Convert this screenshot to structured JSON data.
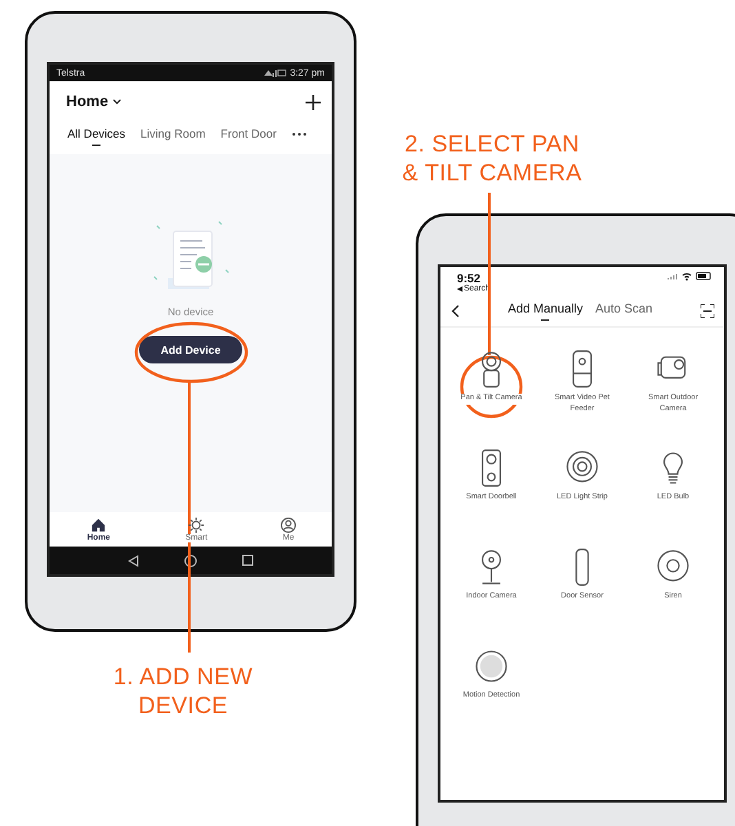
{
  "android_screen": {
    "status_bar": {
      "carrier": "Telstra",
      "time": "3:27 pm"
    },
    "header": {
      "title": "Home"
    },
    "tabs": [
      {
        "label": "All Devices",
        "selected": true
      },
      {
        "label": "Living Room",
        "selected": false
      },
      {
        "label": "Front Door",
        "selected": false
      }
    ],
    "empty_state": {
      "message": "No device",
      "button": "Add Device"
    },
    "bottom_nav": [
      {
        "label": "Home",
        "kind": "home",
        "selected": true
      },
      {
        "label": "Smart",
        "kind": "smart",
        "selected": false
      },
      {
        "label": "Me",
        "kind": "me",
        "selected": false
      }
    ]
  },
  "ios_screen": {
    "status_bar": {
      "time": "9:52",
      "back_label": "Search"
    },
    "tabs": [
      {
        "label": "Add Manually",
        "selected": true
      },
      {
        "label": "Auto Scan",
        "selected": false
      }
    ],
    "devices": [
      {
        "label": "Pan & Tilt Camera",
        "kind": "pantilt"
      },
      {
        "label": "Smart Video Pet Feeder",
        "kind": "feeder"
      },
      {
        "label": "Smart Outdoor Camera",
        "kind": "outdoor"
      },
      {
        "label": "Smart Doorbell",
        "kind": "doorbell"
      },
      {
        "label": "LED Light Strip",
        "kind": "strip"
      },
      {
        "label": "LED Bulb",
        "kind": "bulb"
      },
      {
        "label": "Indoor Camera",
        "kind": "indoor"
      },
      {
        "label": "Door Sensor",
        "kind": "door"
      },
      {
        "label": "Siren",
        "kind": "siren"
      },
      {
        "label": "Motion Detection",
        "kind": "motion"
      }
    ]
  },
  "callouts": [
    {
      "text": "1. ADD NEW\nDEVICE"
    },
    {
      "text": "2. SELECT PAN\n& TILT CAMERA"
    }
  ]
}
